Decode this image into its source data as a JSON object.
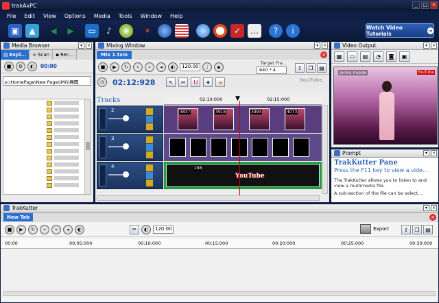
{
  "window": {
    "title": "trakAxPC"
  },
  "menu": [
    "File",
    "Edit",
    "View",
    "Options",
    "Media",
    "Tools",
    "Window",
    "Help"
  ],
  "toolbar": {
    "icons": [
      "save-icon",
      "open-icon",
      "undo-icon",
      "redo-icon",
      "monitor-icon",
      "microphone-icon",
      "cd-icon",
      "effects-icon",
      "globe-icon",
      "timeline-icon",
      "web-icon",
      "help-ring-icon",
      "publish-icon",
      "comment-icon",
      "question-icon",
      "info-icon"
    ],
    "tutorial_label": "Watch Video Tutorials"
  },
  "media_browser": {
    "title": "Media Browser",
    "tabs": [
      "Expl...",
      "Scan",
      "Rec..."
    ],
    "time": "00:00",
    "path": "e:\\HomePage\\New  Page\\IMG\\無聞"
  },
  "mixing": {
    "title": "Mixing Window",
    "tab": "Mix 1.txm",
    "bpm": "120.00",
    "target_label": "Target Fra...",
    "target_value": "640 * 4",
    "time": "02:12:928",
    "youtube": "YouTube",
    "tracks_label": "Tracks",
    "ruler": [
      "02:10:000",
      "02:15:000"
    ],
    "tracks": [
      {
        "num": "2",
        "frames": [
          "3837",
          "3916",
          "3994",
          "4073"
        ]
      },
      {
        "num": "3"
      },
      {
        "num": "4",
        "clip_label": "288",
        "overlay": "YouTube"
      }
    ]
  },
  "video_output": {
    "title": "Video Output",
    "watermark": "Jenka Inside",
    "badge": "YouTube"
  },
  "prompt": {
    "title": "Prompt",
    "heading": "TrakKutter Pane",
    "sub": "Press the F11 key to view a vide...",
    "text1": "The TrakKutter allows you to listen to and view a multimedia file.",
    "text2": "A sub-section of the file can be select..."
  },
  "trakkutter": {
    "title": "TrakKutter",
    "tab": "New Tab",
    "bpm": "120.00",
    "export_label": "Export",
    "ruler": [
      "00:00",
      "00:05:000",
      "00:10:000",
      "00:15:000",
      "00:20:000",
      "00:25:000",
      "00:30:000"
    ]
  }
}
